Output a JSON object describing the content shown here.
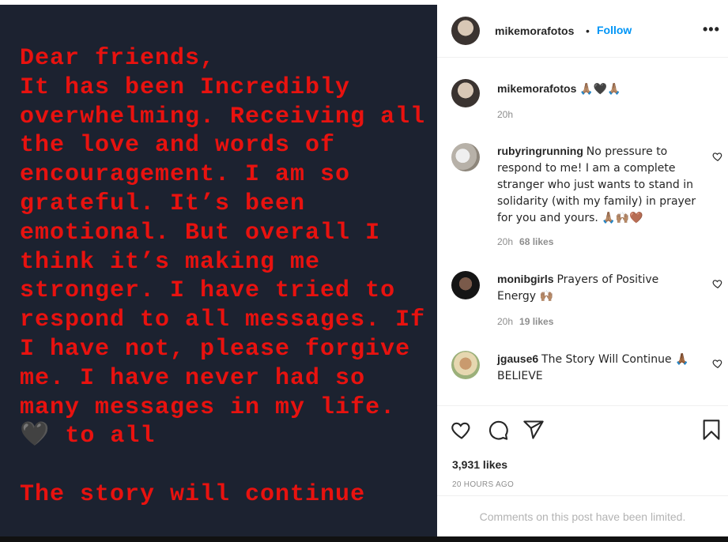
{
  "post_image": {
    "story_text": "Dear friends,\nIt has been Incredibly overwhelming. Receiving all the love and words of encouragement. I am so grateful. It’s been emotional. But overall I think it’s making me stronger. I have tried to respond to all messages. If I have not, please forgive me. I have never had so many messages in my life. 🖤 to all\n\nThe story will continue"
  },
  "header": {
    "username": "mikemorafotos",
    "separator": "•",
    "follow_label": "Follow",
    "more_label": "•••"
  },
  "caption": {
    "username": "mikemorafotos",
    "text": "🙏🏽🖤🙏🏽",
    "time": "20h"
  },
  "comments": [
    {
      "username": "rubyringrunning",
      "text": "No pressure to respond to me! I am a complete stranger who just wants to stand in solidarity (with my family) in prayer for you and yours. 🙏🏽🙌🏽🤎",
      "time": "20h",
      "likes": "68 likes"
    },
    {
      "username": "monibgirls",
      "text": "Prayers of Positive Energy 🙌🏽",
      "time": "20h",
      "likes": "19 likes"
    },
    {
      "username": "jgause6",
      "text": "The Story Will Continue 🙏🏾 BELIEVE",
      "time": "",
      "likes": ""
    }
  ],
  "actions": {
    "likes_count": "3,931 likes",
    "time_ago": "20 HOURS AGO",
    "limited_text": "Comments on this post have been limited."
  },
  "icons": {
    "heart": "heart-icon",
    "comment": "comment-icon",
    "share": "share-icon",
    "save": "bookmark-icon"
  },
  "colors": {
    "story_red": "#e8120f",
    "image_bg": "#1c2230",
    "follow_blue": "#0095f6"
  }
}
